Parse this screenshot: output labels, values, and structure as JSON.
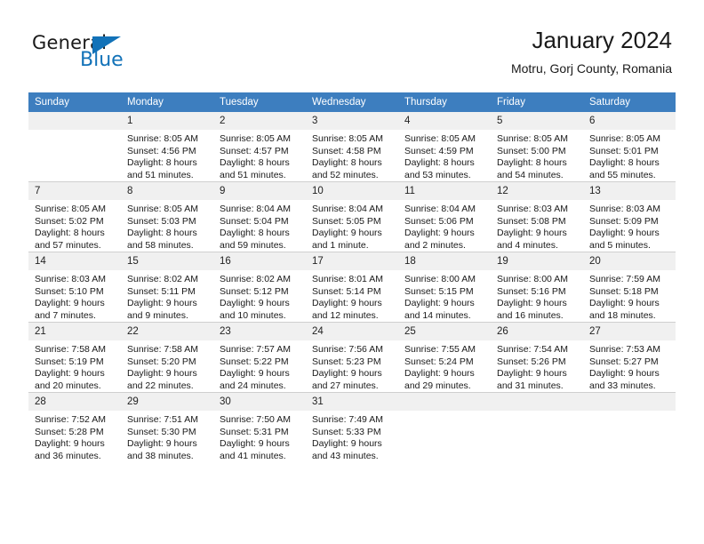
{
  "brand": {
    "name_part1": "General",
    "name_part2": "Blue",
    "accent_color": "#1272b8",
    "triangle_icon": "triangle-icon"
  },
  "header": {
    "title": "January 2024",
    "subtitle": "Motru, Gorj County, Romania"
  },
  "calendar": {
    "header_bg": "#3d7ebf",
    "daynum_bg": "#f0f0f0",
    "weekdays": [
      "Sunday",
      "Monday",
      "Tuesday",
      "Wednesday",
      "Thursday",
      "Friday",
      "Saturday"
    ],
    "weeks": [
      [
        {
          "day": "",
          "sunrise": "",
          "sunset": "",
          "daylight1": "",
          "daylight2": "",
          "blank": true
        },
        {
          "day": "1",
          "sunrise": "Sunrise: 8:05 AM",
          "sunset": "Sunset: 4:56 PM",
          "daylight1": "Daylight: 8 hours",
          "daylight2": "and 51 minutes."
        },
        {
          "day": "2",
          "sunrise": "Sunrise: 8:05 AM",
          "sunset": "Sunset: 4:57 PM",
          "daylight1": "Daylight: 8 hours",
          "daylight2": "and 51 minutes."
        },
        {
          "day": "3",
          "sunrise": "Sunrise: 8:05 AM",
          "sunset": "Sunset: 4:58 PM",
          "daylight1": "Daylight: 8 hours",
          "daylight2": "and 52 minutes."
        },
        {
          "day": "4",
          "sunrise": "Sunrise: 8:05 AM",
          "sunset": "Sunset: 4:59 PM",
          "daylight1": "Daylight: 8 hours",
          "daylight2": "and 53 minutes."
        },
        {
          "day": "5",
          "sunrise": "Sunrise: 8:05 AM",
          "sunset": "Sunset: 5:00 PM",
          "daylight1": "Daylight: 8 hours",
          "daylight2": "and 54 minutes."
        },
        {
          "day": "6",
          "sunrise": "Sunrise: 8:05 AM",
          "sunset": "Sunset: 5:01 PM",
          "daylight1": "Daylight: 8 hours",
          "daylight2": "and 55 minutes."
        }
      ],
      [
        {
          "day": "7",
          "sunrise": "Sunrise: 8:05 AM",
          "sunset": "Sunset: 5:02 PM",
          "daylight1": "Daylight: 8 hours",
          "daylight2": "and 57 minutes."
        },
        {
          "day": "8",
          "sunrise": "Sunrise: 8:05 AM",
          "sunset": "Sunset: 5:03 PM",
          "daylight1": "Daylight: 8 hours",
          "daylight2": "and 58 minutes."
        },
        {
          "day": "9",
          "sunrise": "Sunrise: 8:04 AM",
          "sunset": "Sunset: 5:04 PM",
          "daylight1": "Daylight: 8 hours",
          "daylight2": "and 59 minutes."
        },
        {
          "day": "10",
          "sunrise": "Sunrise: 8:04 AM",
          "sunset": "Sunset: 5:05 PM",
          "daylight1": "Daylight: 9 hours",
          "daylight2": "and 1 minute."
        },
        {
          "day": "11",
          "sunrise": "Sunrise: 8:04 AM",
          "sunset": "Sunset: 5:06 PM",
          "daylight1": "Daylight: 9 hours",
          "daylight2": "and 2 minutes."
        },
        {
          "day": "12",
          "sunrise": "Sunrise: 8:03 AM",
          "sunset": "Sunset: 5:08 PM",
          "daylight1": "Daylight: 9 hours",
          "daylight2": "and 4 minutes."
        },
        {
          "day": "13",
          "sunrise": "Sunrise: 8:03 AM",
          "sunset": "Sunset: 5:09 PM",
          "daylight1": "Daylight: 9 hours",
          "daylight2": "and 5 minutes."
        }
      ],
      [
        {
          "day": "14",
          "sunrise": "Sunrise: 8:03 AM",
          "sunset": "Sunset: 5:10 PM",
          "daylight1": "Daylight: 9 hours",
          "daylight2": "and 7 minutes."
        },
        {
          "day": "15",
          "sunrise": "Sunrise: 8:02 AM",
          "sunset": "Sunset: 5:11 PM",
          "daylight1": "Daylight: 9 hours",
          "daylight2": "and 9 minutes."
        },
        {
          "day": "16",
          "sunrise": "Sunrise: 8:02 AM",
          "sunset": "Sunset: 5:12 PM",
          "daylight1": "Daylight: 9 hours",
          "daylight2": "and 10 minutes."
        },
        {
          "day": "17",
          "sunrise": "Sunrise: 8:01 AM",
          "sunset": "Sunset: 5:14 PM",
          "daylight1": "Daylight: 9 hours",
          "daylight2": "and 12 minutes."
        },
        {
          "day": "18",
          "sunrise": "Sunrise: 8:00 AM",
          "sunset": "Sunset: 5:15 PM",
          "daylight1": "Daylight: 9 hours",
          "daylight2": "and 14 minutes."
        },
        {
          "day": "19",
          "sunrise": "Sunrise: 8:00 AM",
          "sunset": "Sunset: 5:16 PM",
          "daylight1": "Daylight: 9 hours",
          "daylight2": "and 16 minutes."
        },
        {
          "day": "20",
          "sunrise": "Sunrise: 7:59 AM",
          "sunset": "Sunset: 5:18 PM",
          "daylight1": "Daylight: 9 hours",
          "daylight2": "and 18 minutes."
        }
      ],
      [
        {
          "day": "21",
          "sunrise": "Sunrise: 7:58 AM",
          "sunset": "Sunset: 5:19 PM",
          "daylight1": "Daylight: 9 hours",
          "daylight2": "and 20 minutes."
        },
        {
          "day": "22",
          "sunrise": "Sunrise: 7:58 AM",
          "sunset": "Sunset: 5:20 PM",
          "daylight1": "Daylight: 9 hours",
          "daylight2": "and 22 minutes."
        },
        {
          "day": "23",
          "sunrise": "Sunrise: 7:57 AM",
          "sunset": "Sunset: 5:22 PM",
          "daylight1": "Daylight: 9 hours",
          "daylight2": "and 24 minutes."
        },
        {
          "day": "24",
          "sunrise": "Sunrise: 7:56 AM",
          "sunset": "Sunset: 5:23 PM",
          "daylight1": "Daylight: 9 hours",
          "daylight2": "and 27 minutes."
        },
        {
          "day": "25",
          "sunrise": "Sunrise: 7:55 AM",
          "sunset": "Sunset: 5:24 PM",
          "daylight1": "Daylight: 9 hours",
          "daylight2": "and 29 minutes."
        },
        {
          "day": "26",
          "sunrise": "Sunrise: 7:54 AM",
          "sunset": "Sunset: 5:26 PM",
          "daylight1": "Daylight: 9 hours",
          "daylight2": "and 31 minutes."
        },
        {
          "day": "27",
          "sunrise": "Sunrise: 7:53 AM",
          "sunset": "Sunset: 5:27 PM",
          "daylight1": "Daylight: 9 hours",
          "daylight2": "and 33 minutes."
        }
      ],
      [
        {
          "day": "28",
          "sunrise": "Sunrise: 7:52 AM",
          "sunset": "Sunset: 5:28 PM",
          "daylight1": "Daylight: 9 hours",
          "daylight2": "and 36 minutes."
        },
        {
          "day": "29",
          "sunrise": "Sunrise: 7:51 AM",
          "sunset": "Sunset: 5:30 PM",
          "daylight1": "Daylight: 9 hours",
          "daylight2": "and 38 minutes."
        },
        {
          "day": "30",
          "sunrise": "Sunrise: 7:50 AM",
          "sunset": "Sunset: 5:31 PM",
          "daylight1": "Daylight: 9 hours",
          "daylight2": "and 41 minutes."
        },
        {
          "day": "31",
          "sunrise": "Sunrise: 7:49 AM",
          "sunset": "Sunset: 5:33 PM",
          "daylight1": "Daylight: 9 hours",
          "daylight2": "and 43 minutes."
        },
        {
          "day": "",
          "sunrise": "",
          "sunset": "",
          "daylight1": "",
          "daylight2": "",
          "blank": true
        },
        {
          "day": "",
          "sunrise": "",
          "sunset": "",
          "daylight1": "",
          "daylight2": "",
          "blank": true
        },
        {
          "day": "",
          "sunrise": "",
          "sunset": "",
          "daylight1": "",
          "daylight2": "",
          "blank": true
        }
      ]
    ]
  }
}
